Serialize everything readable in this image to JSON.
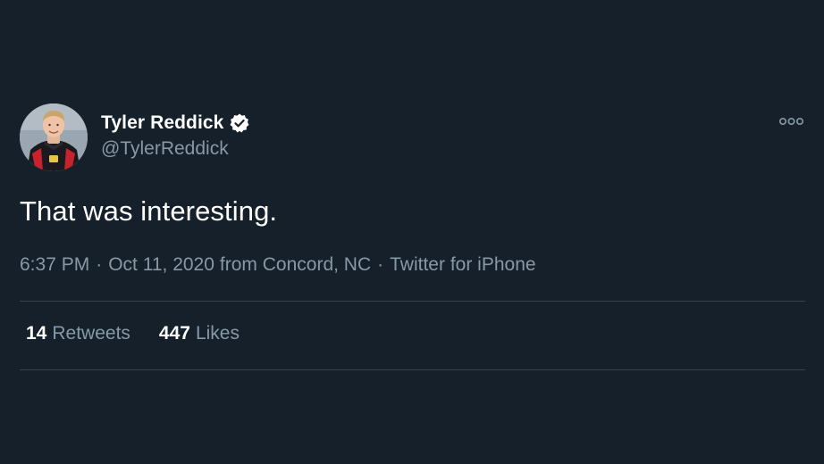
{
  "user": {
    "display_name": "Tyler Reddick",
    "handle": "@TylerReddick",
    "verified_icon": "verified-badge-icon",
    "avatar_icon": "profile-photo"
  },
  "tweet": {
    "text": "That was interesting.",
    "time": "6:37 PM",
    "date": "Oct 11, 2020",
    "location": "from Concord, NC",
    "source": "Twitter for iPhone",
    "separator": "·"
  },
  "stats": {
    "retweets_count": "14",
    "retweets_label": "Retweets",
    "likes_count": "447",
    "likes_label": "Likes"
  },
  "more_icon": "more-options-icon",
  "colors": {
    "background": "#15202b",
    "primary_text": "#ffffff",
    "secondary_text": "#8899a6",
    "divider": "#38444d"
  }
}
